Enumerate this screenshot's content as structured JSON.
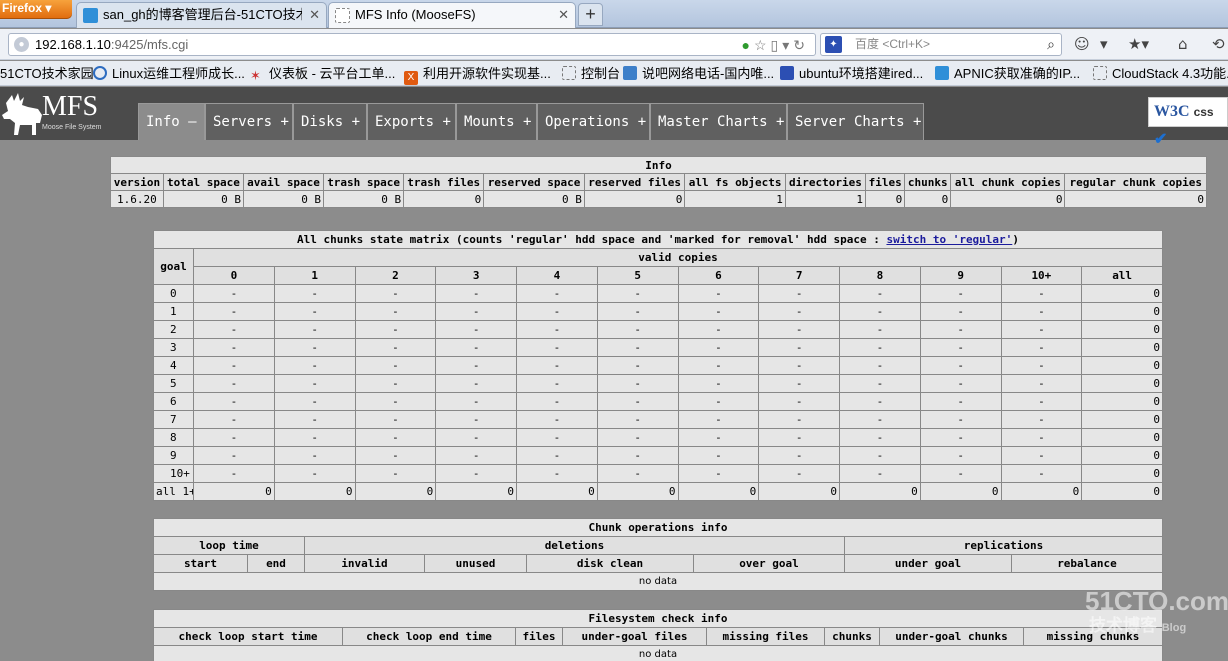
{
  "browser": {
    "firefox_button": "Firefox",
    "tabs": [
      {
        "label": "san_gh的博客管理后台-51CTO技术...",
        "active": false
      },
      {
        "label": "MFS Info (MooseFS)",
        "active": true
      }
    ],
    "new_tab": "+",
    "url_host": "192.168.1.10",
    "url_rest": ":9425/mfs.cgi",
    "search_placeholder": "百度 <Ctrl+K>",
    "bookmarks": [
      "51CTO技术家园",
      "Linux运维工程师成长...",
      "仪表板 - 云平台工单...",
      "利用开源软件实现基...",
      "控制台",
      "说吧网络电话-国内唯...",
      "ubuntu环境搭建ired...",
      "APNIC获取准确的IP...",
      "CloudStack 4.3功能..."
    ]
  },
  "mfs": {
    "logo": "MFS",
    "logo_sub": "Moose File System",
    "menu": [
      {
        "label": "Info",
        "sign": "—"
      },
      {
        "label": "Servers",
        "sign": "+"
      },
      {
        "label": "Disks",
        "sign": "+"
      },
      {
        "label": "Exports",
        "sign": "+"
      },
      {
        "label": "Mounts",
        "sign": "+"
      },
      {
        "label": "Operations",
        "sign": "+"
      },
      {
        "label": "Master Charts",
        "sign": "+"
      },
      {
        "label": "Server Charts",
        "sign": "+"
      }
    ],
    "w3c": "W3C",
    "w3c_css": "css"
  },
  "info": {
    "title": "Info",
    "headers": [
      "version",
      "total space",
      "avail space",
      "trash space",
      "trash files",
      "reserved space",
      "reserved files",
      "all fs objects",
      "directories",
      "files",
      "chunks",
      "all chunk copies",
      "regular chunk copies"
    ],
    "values": [
      "1.6.20",
      "0 B",
      "0 B",
      "0 B",
      "0",
      "0 B",
      "0",
      "1",
      "1",
      "0",
      "0",
      "0",
      "0"
    ]
  },
  "matrix": {
    "title_prefix": "All chunks state matrix (counts 'regular' hdd space and 'marked for removal' hdd space : ",
    "title_link": "switch to 'regular'",
    "title_suffix": ")",
    "goal_header": "goal",
    "valid_header": "valid copies",
    "columns": [
      "0",
      "1",
      "2",
      "3",
      "4",
      "5",
      "6",
      "7",
      "8",
      "9",
      "10+",
      "all"
    ],
    "rows": [
      {
        "goal": "0",
        "cells": [
          "-",
          "-",
          "-",
          "-",
          "-",
          "-",
          "-",
          "-",
          "-",
          "-",
          "-"
        ],
        "all": "0"
      },
      {
        "goal": "1",
        "cells": [
          "-",
          "-",
          "-",
          "-",
          "-",
          "-",
          "-",
          "-",
          "-",
          "-",
          "-"
        ],
        "all": "0"
      },
      {
        "goal": "2",
        "cells": [
          "-",
          "-",
          "-",
          "-",
          "-",
          "-",
          "-",
          "-",
          "-",
          "-",
          "-"
        ],
        "all": "0"
      },
      {
        "goal": "3",
        "cells": [
          "-",
          "-",
          "-",
          "-",
          "-",
          "-",
          "-",
          "-",
          "-",
          "-",
          "-"
        ],
        "all": "0"
      },
      {
        "goal": "4",
        "cells": [
          "-",
          "-",
          "-",
          "-",
          "-",
          "-",
          "-",
          "-",
          "-",
          "-",
          "-"
        ],
        "all": "0"
      },
      {
        "goal": "5",
        "cells": [
          "-",
          "-",
          "-",
          "-",
          "-",
          "-",
          "-",
          "-",
          "-",
          "-",
          "-"
        ],
        "all": "0"
      },
      {
        "goal": "6",
        "cells": [
          "-",
          "-",
          "-",
          "-",
          "-",
          "-",
          "-",
          "-",
          "-",
          "-",
          "-"
        ],
        "all": "0"
      },
      {
        "goal": "7",
        "cells": [
          "-",
          "-",
          "-",
          "-",
          "-",
          "-",
          "-",
          "-",
          "-",
          "-",
          "-"
        ],
        "all": "0"
      },
      {
        "goal": "8",
        "cells": [
          "-",
          "-",
          "-",
          "-",
          "-",
          "-",
          "-",
          "-",
          "-",
          "-",
          "-"
        ],
        "all": "0"
      },
      {
        "goal": "9",
        "cells": [
          "-",
          "-",
          "-",
          "-",
          "-",
          "-",
          "-",
          "-",
          "-",
          "-",
          "-"
        ],
        "all": "0"
      },
      {
        "goal": "10+",
        "cells": [
          "-",
          "-",
          "-",
          "-",
          "-",
          "-",
          "-",
          "-",
          "-",
          "-",
          "-"
        ],
        "all": "0"
      }
    ],
    "all_row": {
      "goal": "all 1+",
      "cells": [
        "0",
        "0",
        "0",
        "0",
        "0",
        "0",
        "0",
        "0",
        "0",
        "0",
        "0"
      ],
      "all": "0"
    }
  },
  "chunkops": {
    "title": "Chunk operations info",
    "groups": [
      "loop time",
      "deletions",
      "replications"
    ],
    "columns": [
      "start",
      "end",
      "invalid",
      "unused",
      "disk clean",
      "over goal",
      "under goal",
      "rebalance"
    ],
    "no_data": "no data"
  },
  "fscheck": {
    "title": "Filesystem check info",
    "columns": [
      "check loop start time",
      "check loop end time",
      "files",
      "under-goal files",
      "missing files",
      "chunks",
      "under-goal chunks",
      "missing chunks"
    ],
    "no_data": "no data"
  },
  "watermark": {
    "main": "51CTO.com",
    "sub": "技术博客",
    "blog": "Blog"
  }
}
